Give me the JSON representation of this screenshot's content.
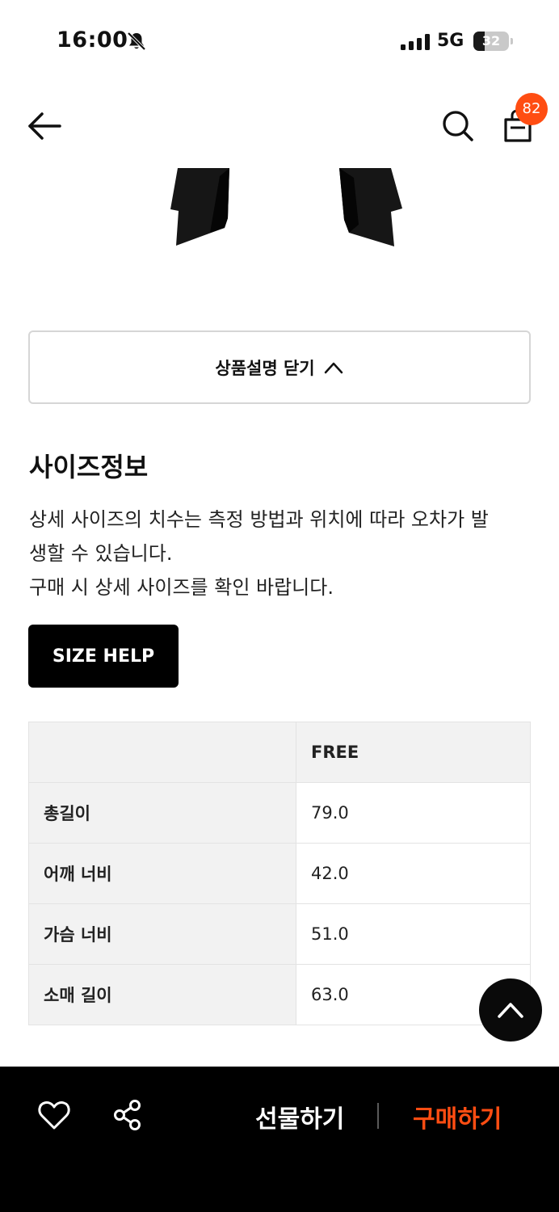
{
  "status_bar": {
    "time": "16:00",
    "network": "5G",
    "battery_level": "32",
    "battery_fraction": 0.32
  },
  "header": {
    "back_icon": "arrow-left-icon",
    "search_icon": "search-icon",
    "cart_icon": "shopping-bag-icon",
    "cart_count": "82"
  },
  "product": {
    "close_description_label": "상품설명 닫기"
  },
  "size_info": {
    "title": "사이즈정보",
    "note_lines": [
      "상세 사이즈의 치수는 측정 방법과 위치에 따라 오차가 발",
      "생할 수 있습니다.",
      "구매 시 상세 사이즈를 확인 바랍니다."
    ],
    "help_button_label": "SIZE HELP",
    "table": {
      "header": [
        "",
        "FREE"
      ],
      "rows": [
        {
          "label": "총길이",
          "value": "79.0"
        },
        {
          "label": "어깨 너비",
          "value": "42.0"
        },
        {
          "label": "가슴 너비",
          "value": "51.0"
        },
        {
          "label": "소매 길이",
          "value": "63.0"
        }
      ]
    }
  },
  "bottom_bar": {
    "gift_label": "선물하기",
    "buy_label": "구매하기"
  },
  "colors": {
    "accent": "#ff4d12",
    "black": "#000000",
    "table_header_bg": "#f2f2f2"
  }
}
